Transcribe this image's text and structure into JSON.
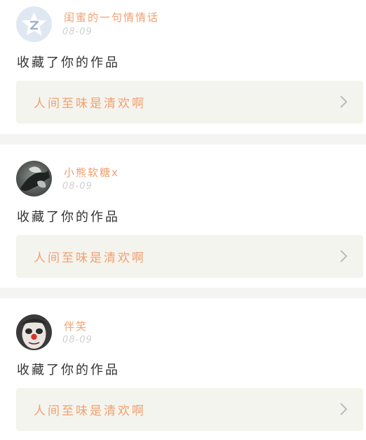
{
  "theme": {
    "accent": "#f0a070",
    "chevron": "#bbbbbb"
  },
  "posts": [
    {
      "avatar_icon": "qzone-star-icon",
      "username": "闺蜜的一句情情话",
      "date": "08-09",
      "action": "收藏了你的作品",
      "work_title": "人间至味是清欢啊"
    },
    {
      "avatar_icon": "flower-photo-avatar",
      "username": "小熊软糖x",
      "date": "08-09",
      "action": "收藏了你的作品",
      "work_title": "人间至味是清欢啊"
    },
    {
      "avatar_icon": "clown-face-avatar",
      "username": "伴笑",
      "date": "08-09",
      "action": "收藏了你的作品",
      "work_title": "人间至味是清欢啊"
    }
  ]
}
